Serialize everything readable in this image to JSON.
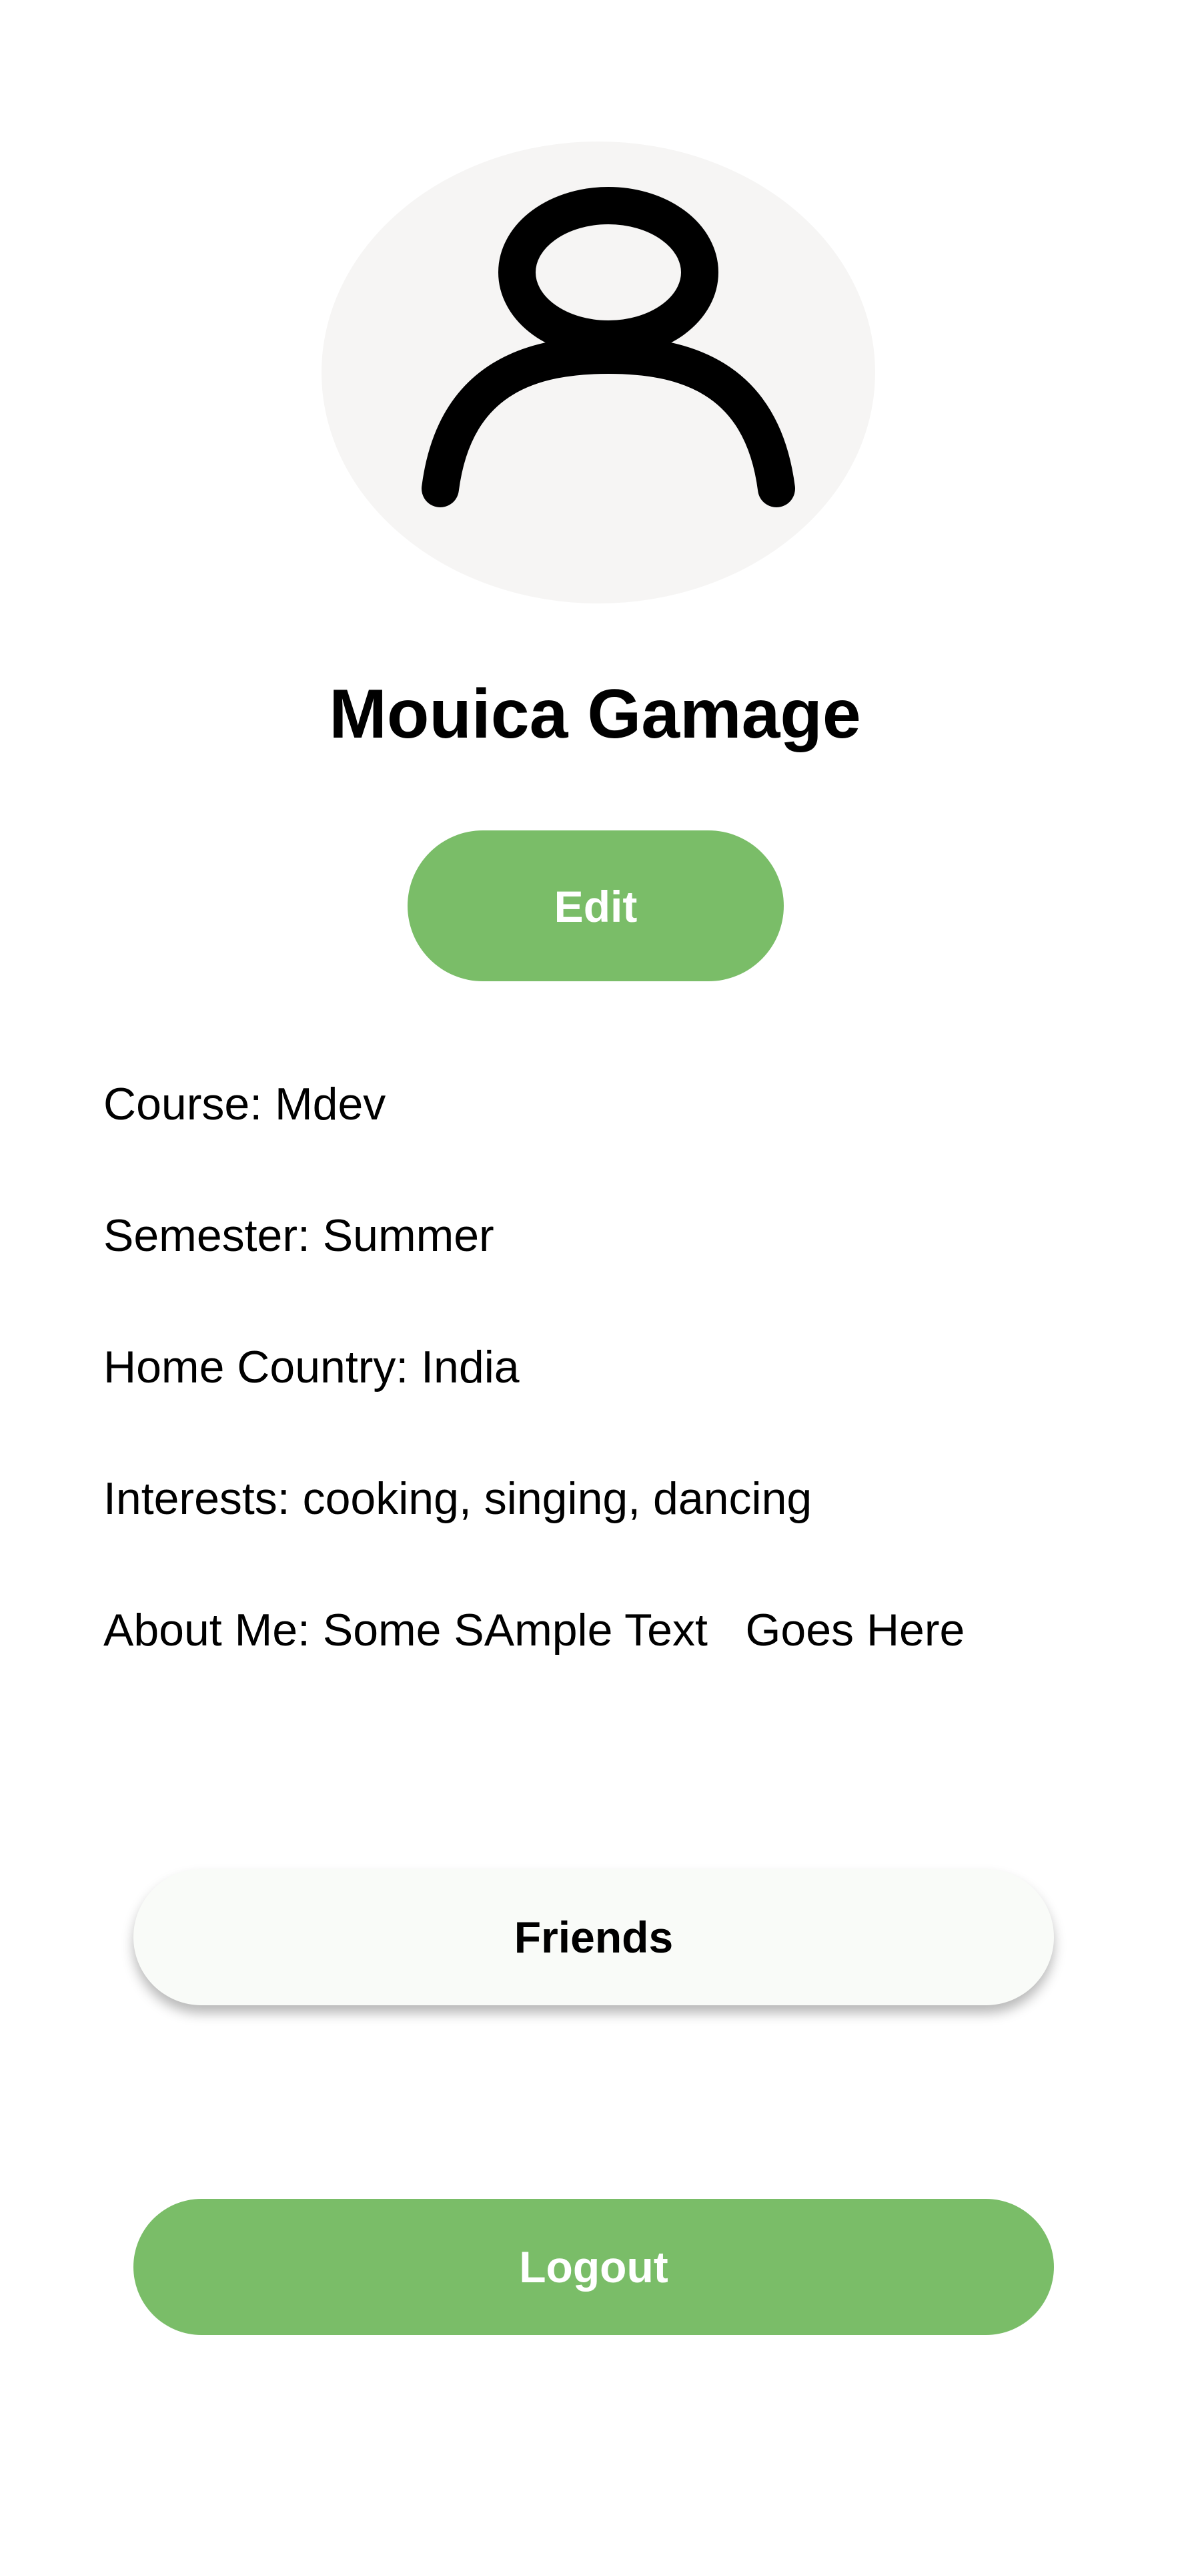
{
  "profile": {
    "name": "Mouica Gamage",
    "avatar_icon": "user-icon",
    "avatar_bg": "#f6f5f4"
  },
  "buttons": {
    "edit_label": "Edit",
    "friends_label": "Friends",
    "logout_label": "Logout"
  },
  "details": {
    "course": "Course: Mdev",
    "semester": "Semester: Summer",
    "home_country": "Home Country: India",
    "interests": "Interests: cooking, singing, dancing",
    "about_me": "About Me: Some SAmple Text   Goes Here"
  },
  "colors": {
    "accent": "#7abd68",
    "background": "#ffffff",
    "text": "#000000"
  }
}
